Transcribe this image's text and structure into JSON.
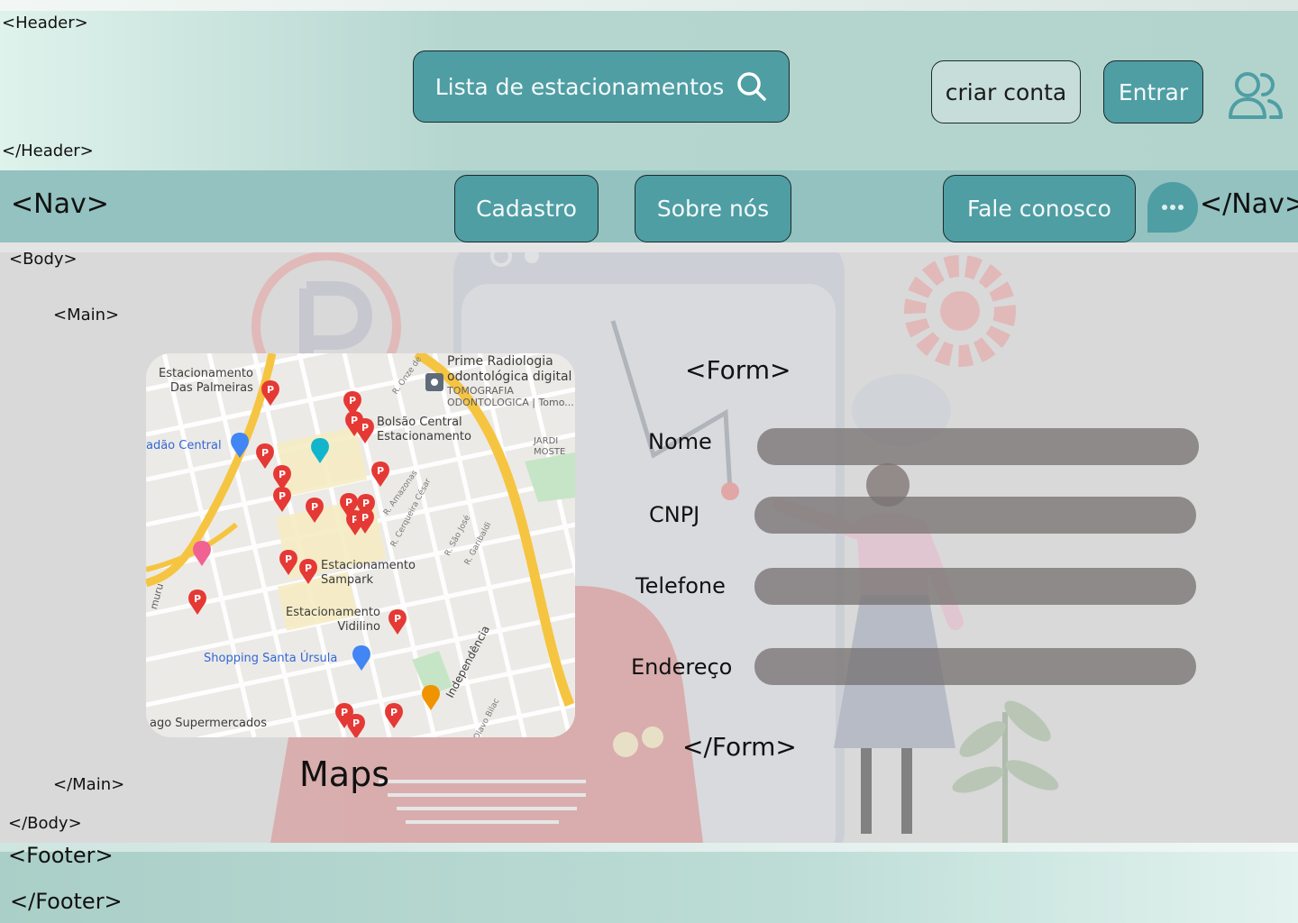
{
  "header": {
    "open_tag": "<Header>",
    "close_tag": "</Header>",
    "search_button_label": "Lista de estacionamentos",
    "create_account_label": "criar conta",
    "login_label": "Entrar"
  },
  "nav": {
    "open_tag": "<Nav>",
    "close_tag": "</Nav>",
    "items": [
      {
        "label": "Cadastro"
      },
      {
        "label": "Sobre nós"
      },
      {
        "label": "Fale conosco"
      }
    ]
  },
  "body": {
    "open_tag": "<Body>",
    "close_tag": "</Body>",
    "main_open_tag": "<Main>",
    "main_close_tag": "</Main>",
    "maps_caption": "Maps"
  },
  "map": {
    "labels": {
      "estacionamento_palmeiras": "Estacionamento\nDas Palmeiras",
      "prime": "Prime Radiologia\nodontológica digital",
      "prime_sub": "TOMOGRAFIA\nODONTOLOGICA | Tomo...",
      "bolsao": "Bolsão Central\nEstacionamento",
      "adao": "adão Central",
      "sampark": "Estacionamento\nSampark",
      "vidilino": "Estacionamento\nVidilino",
      "shopping": "Shopping Santa Úrsula",
      "supermercados": "ago Supermercados",
      "jardim": "JARDI\nMOSTE",
      "independencia": "Independência",
      "r_onze": "R. Onze de",
      "r_amazonas": "R. Amazonas",
      "r_cerqueira": "R. Cerqueira César",
      "r_sao_jose": "R. São José",
      "r_garibaldi": "R. Garibaldi",
      "olavo": "Olavo Bilac",
      "muru": "muru"
    }
  },
  "form": {
    "open_tag": "<Form>",
    "close_tag": "</Form>",
    "fields": [
      {
        "label": "Nome"
      },
      {
        "label": "CNPJ"
      },
      {
        "label": "Telefone"
      },
      {
        "label": "Endereço"
      }
    ]
  },
  "footer": {
    "open_tag": "<Footer>",
    "close_tag": "</Footer>"
  },
  "colors": {
    "accent": "#4f9ea4",
    "nav_bg": "#93c2c0",
    "body_bg": "#d9d9d9",
    "pin": "#e53935",
    "road": "#f5c542"
  }
}
